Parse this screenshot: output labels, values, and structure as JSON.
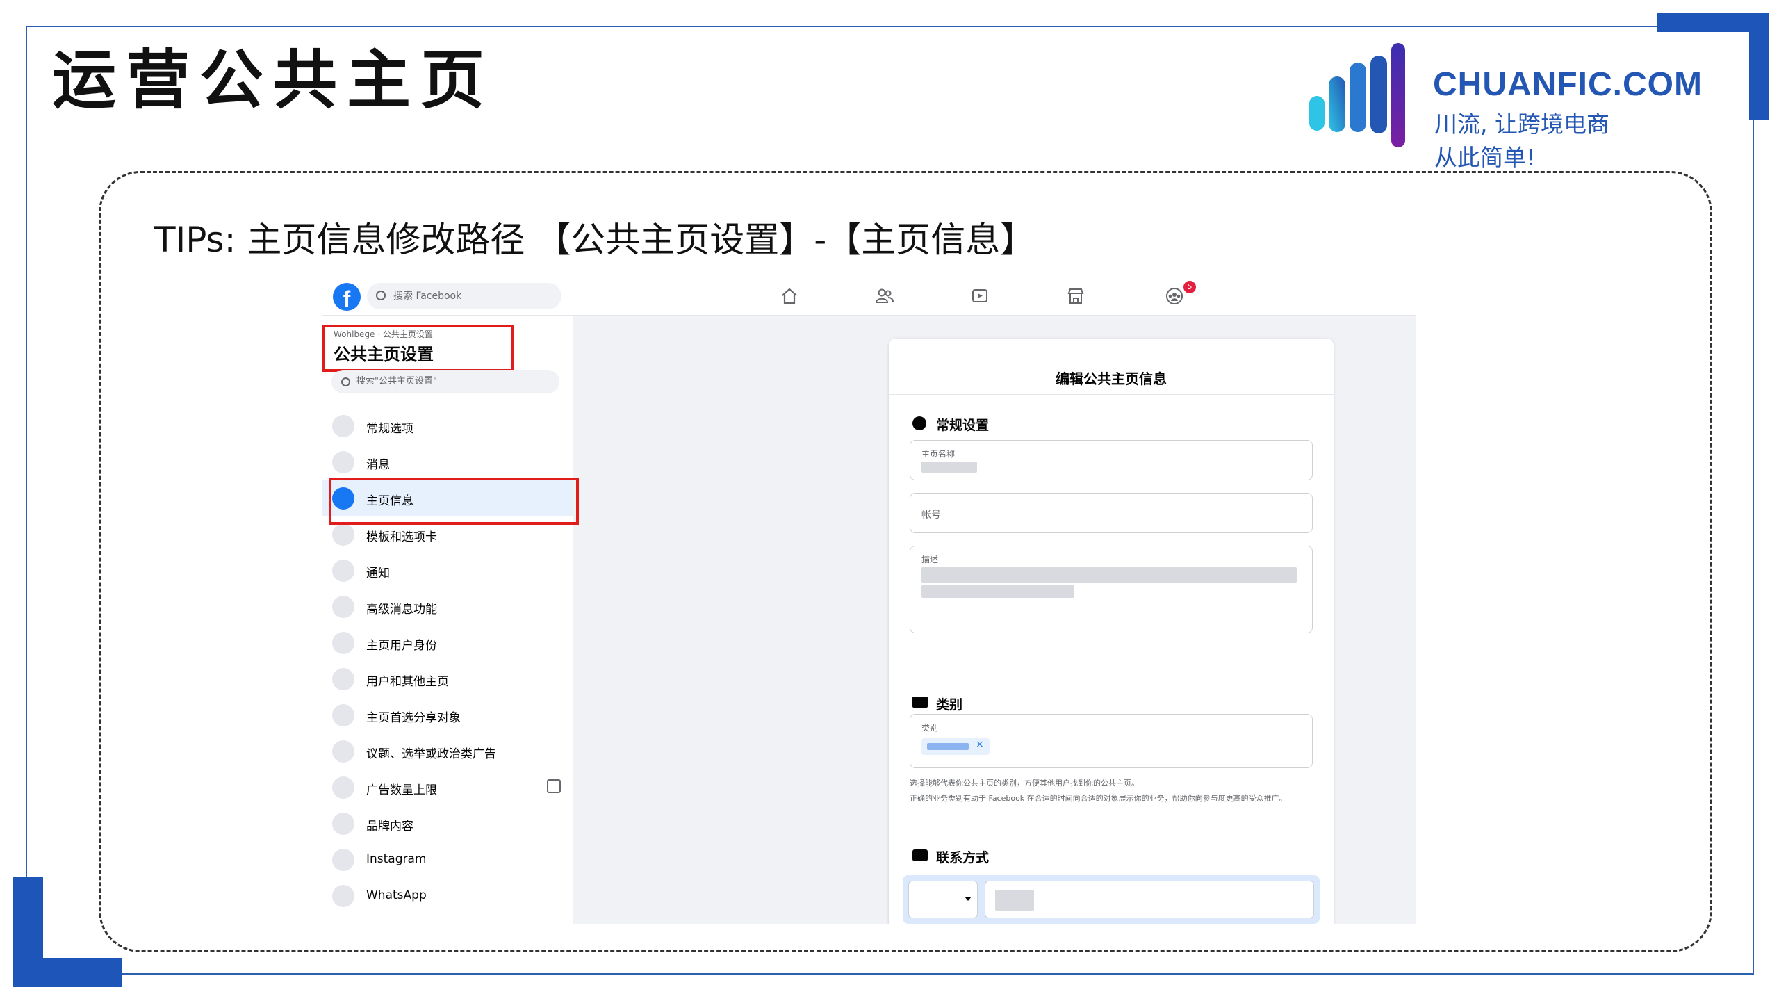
{
  "slide": {
    "title": "运营公共主页",
    "tips": "TIPs: 主页信息修改路径 【公共主页设置】-【主页信息】"
  },
  "logo": {
    "brand": "CHUANFIC.COM",
    "slogan": "川流, 让跨境电商从此简单!"
  },
  "colors": {
    "frame_blue": "#1d55b8",
    "facebook_blue": "#1877f2",
    "highlight_red": "#e21b1b"
  },
  "facebook": {
    "search_placeholder": "搜索 Facebook",
    "nav_icons": [
      "home-icon",
      "friends-icon",
      "watch-icon",
      "marketplace-icon",
      "groups-icon"
    ],
    "notification_badge": "5",
    "sidebar": {
      "breadcrumb": "Wohlbege · 公共主页设置",
      "title": "公共主页设置",
      "search_placeholder": "搜索\"公共主页设置\"",
      "items": [
        {
          "label": "常规选项",
          "icon": "gear-icon"
        },
        {
          "label": "消息",
          "icon": "chat-icon"
        },
        {
          "label": "主页信息",
          "icon": "pencil-icon",
          "active": true
        },
        {
          "label": "模板和选项卡",
          "icon": "grid-icon"
        },
        {
          "label": "通知",
          "icon": "globe-icon"
        },
        {
          "label": "高级消息功能",
          "icon": "messenger-icon"
        },
        {
          "label": "主页用户身份",
          "icon": "person-icon"
        },
        {
          "label": "用户和其他主页",
          "icon": "people-icon"
        },
        {
          "label": "主页首选分享对象",
          "icon": "people-icon"
        },
        {
          "label": "议题、选举或政治类广告",
          "icon": "wrench-icon"
        },
        {
          "label": "广告数量上限",
          "icon": "gear-icon"
        },
        {
          "label": "品牌内容",
          "icon": "handshake-icon"
        },
        {
          "label": "Instagram",
          "icon": "instagram-icon"
        },
        {
          "label": "WhatsApp",
          "icon": "whatsapp-icon"
        }
      ]
    },
    "card": {
      "title": "编辑公共主页信息",
      "general": {
        "heading": "常规设置",
        "name_label": "主页名称",
        "account_placeholder": "帐号",
        "description_label": "描述"
      },
      "category": {
        "heading": "类别",
        "label": "类别",
        "help1": "选择能够代表你公共主页的类别，方便其他用户找到你的公共主页。",
        "help2": "正确的业务类别有助于 Facebook 在合适的时间向合适的对象展示你的业务，帮助你向参与度更高的受众推广。"
      },
      "contact": {
        "heading": "联系方式"
      }
    }
  }
}
